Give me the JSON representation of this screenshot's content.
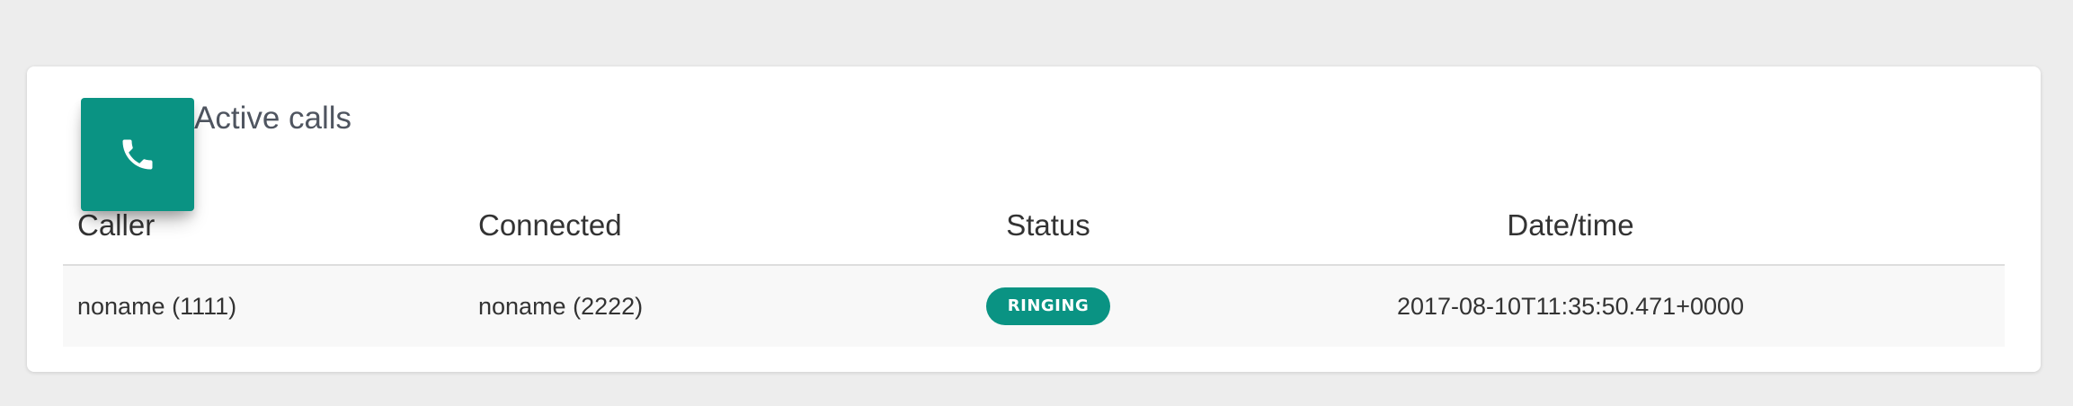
{
  "panel": {
    "icon": "phone-icon",
    "title": "Active calls",
    "accent_color": "#0a9383"
  },
  "table": {
    "columns": [
      "Caller",
      "Connected",
      "Status",
      "Date/time"
    ],
    "rows": [
      {
        "caller": "noname (1111)",
        "connected": "noname (2222)",
        "status": "RINGING",
        "datetime": "2017-08-10T11:35:50.471+0000"
      }
    ]
  }
}
